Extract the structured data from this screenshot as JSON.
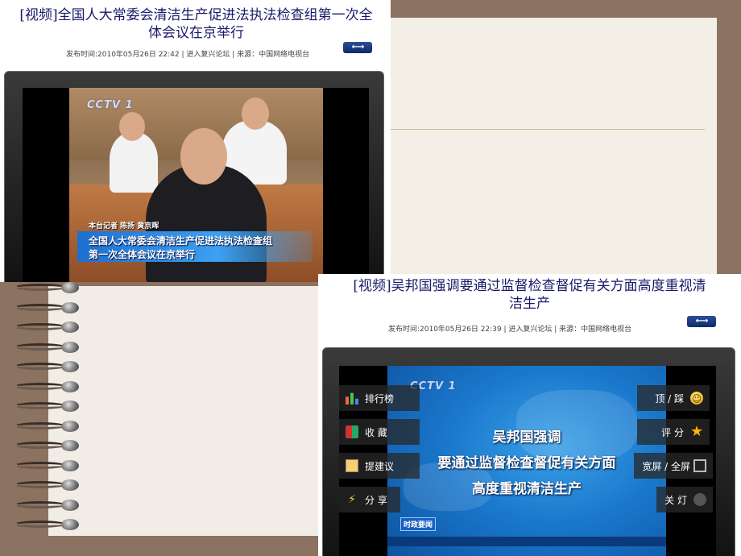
{
  "panel1": {
    "title_line1": "[视频]全国人大常委会清洁生产促进法执法检查组第一次全",
    "title_line2": "体会议在京举行",
    "meta": "发布时间:2010年05月26日  22:42 | 进入复兴论坛 | 来源：中国网络电视台",
    "arrows": "←→",
    "video": {
      "logo": "CCTV 1",
      "reporter": "本台记者 陈扬 黄京晖",
      "caption_line1": "全国人大常委会清洁生产促进法执法检查组",
      "caption_line2": "第一次全体会议在京举行"
    }
  },
  "panel2": {
    "title_line1": "[视频]吴邦国强调要通过监督检查督促有关方面高度重视清",
    "title_line2": "洁生产",
    "meta": "发布时间:2010年05月26日  22:39 | 进入复兴论坛 | 来源：中国网络电视台",
    "arrows": "←→",
    "video": {
      "logo": "CCTV 1",
      "line1": "吴邦国强调",
      "line2": "要通过监督检查督促有关方面",
      "line3": "高度重视清洁生产",
      "tag": "时政要闻"
    },
    "side_left": [
      {
        "label": "排行榜",
        "icon": "bar-chart-icon"
      },
      {
        "label": "收 藏",
        "icon": "bookmark-icon"
      },
      {
        "label": "提建议",
        "icon": "note-icon"
      },
      {
        "label": "分 享",
        "icon": "share-icon"
      }
    ],
    "side_right": [
      {
        "label": "顶 / 踩",
        "icon": "smile-icon"
      },
      {
        "label": "评 分",
        "icon": "star-icon"
      },
      {
        "label": "宽屏 / 全屏",
        "icon": "screen-icon"
      },
      {
        "label": "关 灯",
        "icon": "light-icon"
      }
    ]
  }
}
